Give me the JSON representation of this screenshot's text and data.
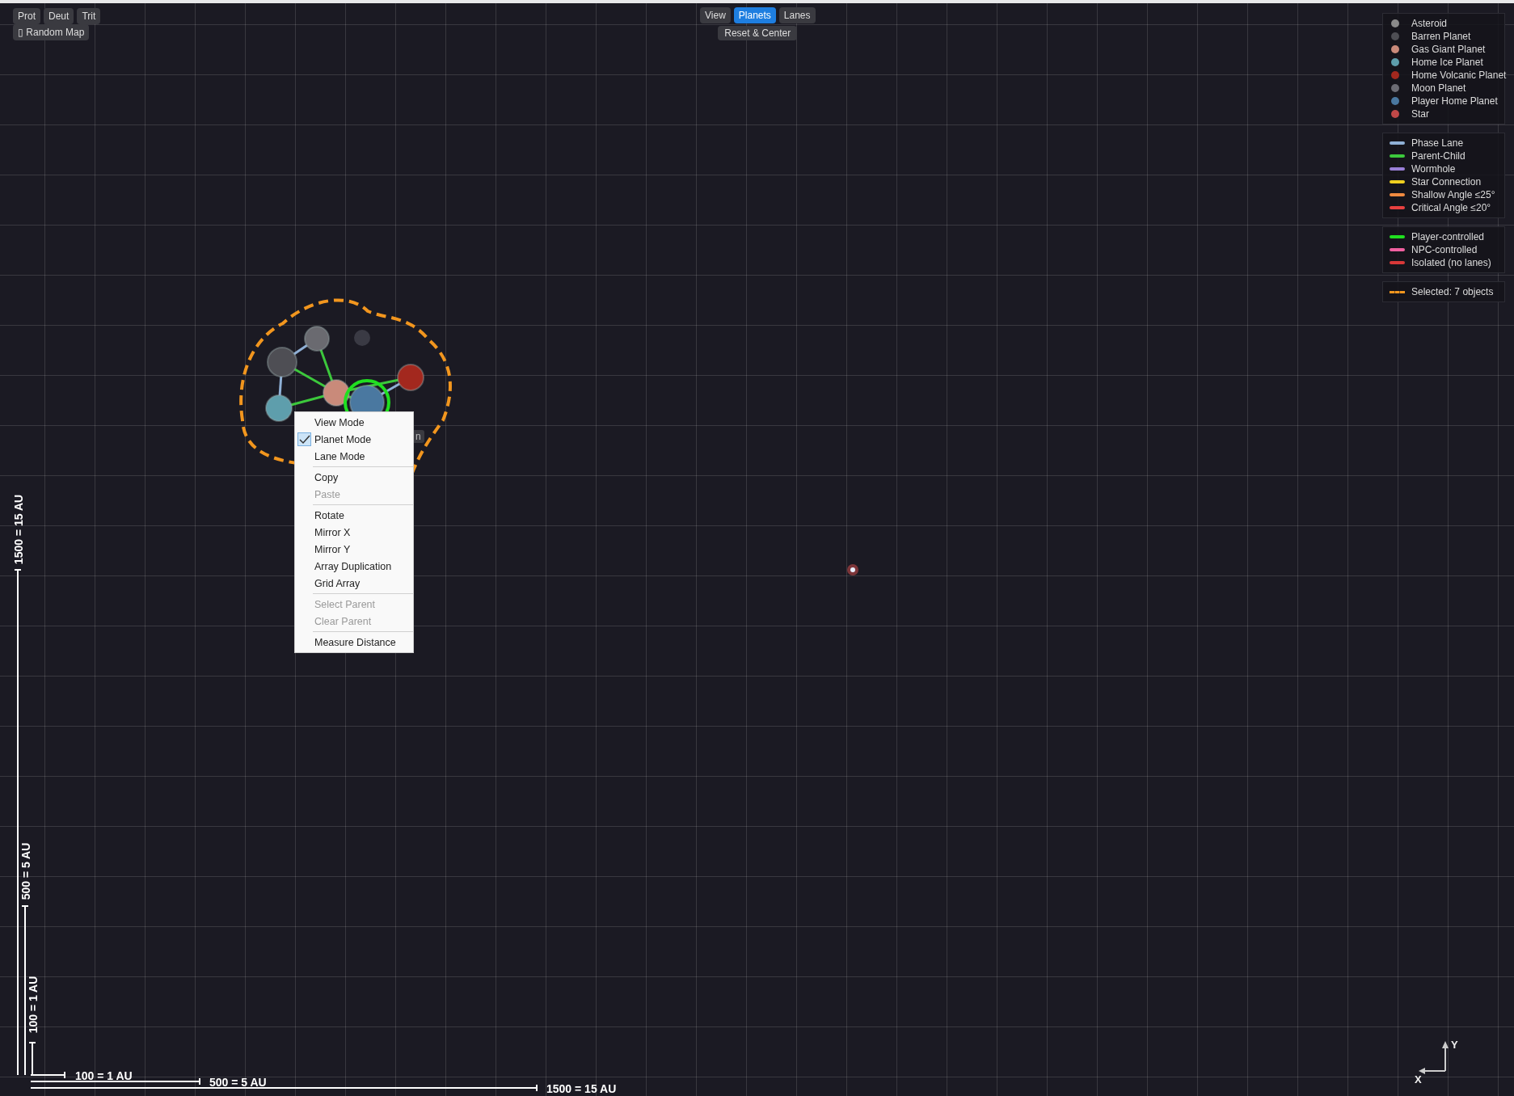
{
  "resource_buttons": [
    {
      "label": "Prot"
    },
    {
      "label": "Deut"
    },
    {
      "label": "Trit"
    }
  ],
  "random_map": {
    "label": "▯ Random Map"
  },
  "mode_tabs": [
    {
      "label": "View",
      "selected": false
    },
    {
      "label": "Planets",
      "selected": true
    },
    {
      "label": "Lanes",
      "selected": false
    }
  ],
  "reset_button": {
    "label": "Reset & Center"
  },
  "legend": {
    "planet_types": [
      {
        "label": "Asteroid",
        "color": "#8a8a8a"
      },
      {
        "label": "Barren Planet",
        "color": "#4e4e54"
      },
      {
        "label": "Gas Giant Planet",
        "color": "#c98a7a"
      },
      {
        "label": "Home Ice Planet",
        "color": "#5e9eac"
      },
      {
        "label": "Home Volcanic Planet",
        "color": "#a3281e"
      },
      {
        "label": "Moon Planet",
        "color": "#6c6c74"
      },
      {
        "label": "Player Home Planet",
        "color": "#4a78a0"
      },
      {
        "label": "Star",
        "color": "#c04848"
      }
    ],
    "lane_types": [
      {
        "label": "Phase Lane",
        "color": "#8fb0d6"
      },
      {
        "label": "Parent-Child",
        "color": "#3cc83c"
      },
      {
        "label": "Wormhole",
        "color": "#9a7fd8"
      },
      {
        "label": "Star Connection",
        "color": "#f0d020"
      },
      {
        "label": "Shallow Angle ≤25°",
        "color": "#f08a40"
      },
      {
        "label": "Critical Angle ≤20°",
        "color": "#e84040"
      }
    ],
    "control_types": [
      {
        "label": "Player-controlled",
        "color": "#20e020"
      },
      {
        "label": "NPC-controlled",
        "color": "#f060a0"
      },
      {
        "label": "Isolated (no lanes)",
        "color": "#d83838"
      }
    ],
    "selection": {
      "label": "Selected: 7 objects"
    }
  },
  "planet_label": "n",
  "context_menu": {
    "items": [
      {
        "kind": "item",
        "label": "View Mode",
        "checked": false,
        "disabled": false
      },
      {
        "kind": "item",
        "label": "Planet Mode",
        "checked": true,
        "disabled": false
      },
      {
        "kind": "item",
        "label": "Lane Mode",
        "checked": false,
        "disabled": false
      },
      {
        "kind": "separator"
      },
      {
        "kind": "item",
        "label": "Copy",
        "checked": false,
        "disabled": false
      },
      {
        "kind": "item",
        "label": "Paste",
        "checked": false,
        "disabled": true
      },
      {
        "kind": "separator"
      },
      {
        "kind": "item",
        "label": "Rotate",
        "checked": false,
        "disabled": false
      },
      {
        "kind": "item",
        "label": "Mirror X",
        "checked": false,
        "disabled": false
      },
      {
        "kind": "item",
        "label": "Mirror Y",
        "checked": false,
        "disabled": false
      },
      {
        "kind": "item",
        "label": "Array Duplication",
        "checked": false,
        "disabled": false
      },
      {
        "kind": "item",
        "label": "Grid Array",
        "checked": false,
        "disabled": false
      },
      {
        "kind": "separator"
      },
      {
        "kind": "item",
        "label": "Select Parent",
        "checked": false,
        "disabled": true
      },
      {
        "kind": "item",
        "label": "Clear Parent",
        "checked": false,
        "disabled": true
      },
      {
        "kind": "separator"
      },
      {
        "kind": "item",
        "label": "Measure Distance",
        "checked": false,
        "disabled": false
      }
    ]
  },
  "scale_bars": {
    "vertical": [
      {
        "label": "1500 = 15 AU"
      },
      {
        "label": "500 = 5 AU"
      },
      {
        "label": "100 = 1 AU"
      }
    ],
    "horizontal": [
      {
        "label": "100 = 1 AU"
      },
      {
        "label": "500 = 5 AU"
      },
      {
        "label": "1500 = 15 AU"
      }
    ]
  },
  "axes": {
    "x_label": "X",
    "y_label": "Y"
  }
}
